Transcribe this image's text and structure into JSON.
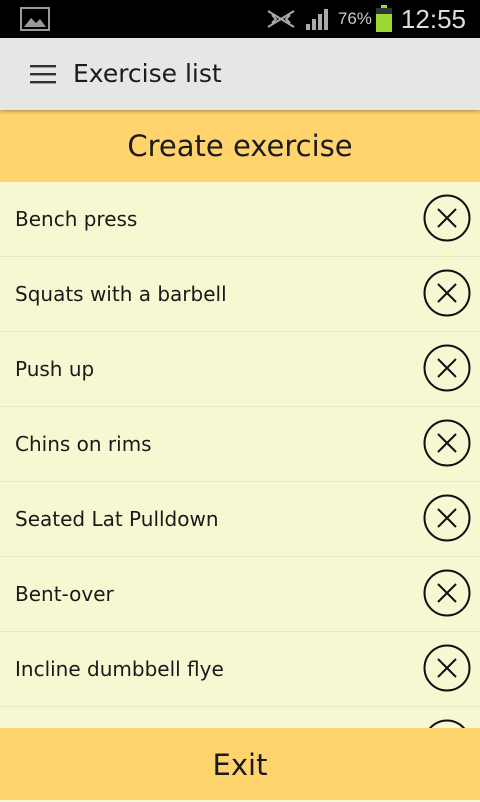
{
  "status_bar": {
    "battery_percent": "76%",
    "time": "12:55",
    "icons": [
      "gallery-icon",
      "mute-icon",
      "signal-icon",
      "battery-icon"
    ]
  },
  "action_bar": {
    "title": "Exercise list",
    "menu_icon": "hamburger-menu-icon"
  },
  "create_button": {
    "label": "Create exercise"
  },
  "exercises": [
    {
      "name": "Bench press"
    },
    {
      "name": "Squats with a barbell"
    },
    {
      "name": "Push up"
    },
    {
      "name": "Chins on rims"
    },
    {
      "name": "Seated Lat Pulldown"
    },
    {
      "name": "Bent-over"
    },
    {
      "name": "Incline dumbbell flye"
    }
  ],
  "exit_button": {
    "label": "Exit"
  },
  "colors": {
    "status_bar_bg": "#000000",
    "action_bar_bg": "#e6e6e6",
    "accent_yellow": "#ffd46d",
    "list_bg": "#f7f7d2",
    "battery_green": "#9ad936"
  }
}
